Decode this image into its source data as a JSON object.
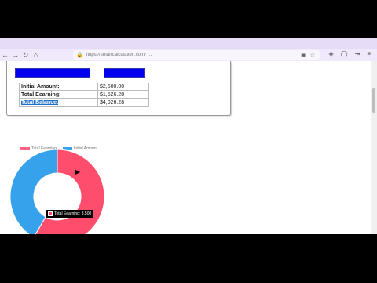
{
  "browser": {
    "url": "https://smartcalculation.com/ …",
    "tab_icons": [
      "back-icon",
      "forward-icon",
      "reload-icon",
      "home-icon"
    ]
  },
  "calculator": {
    "button_left": "",
    "button_right": "",
    "rows": [
      {
        "label": "Initial Amount:",
        "value": "$2,500.00"
      },
      {
        "label": "Total Eearning:",
        "value": "$1,526.28"
      },
      {
        "label": "Total Balance:",
        "value": "$4,026.28"
      }
    ]
  },
  "chart_data": {
    "type": "pie",
    "categories": [
      "Total Eearning",
      "Initial Amount"
    ],
    "values": [
      3500,
      2500
    ],
    "colors": [
      "#ff4d6d",
      "#36a2eb"
    ],
    "legend": "top"
  },
  "tooltip": {
    "text": "Total Eearning: 3,500"
  }
}
